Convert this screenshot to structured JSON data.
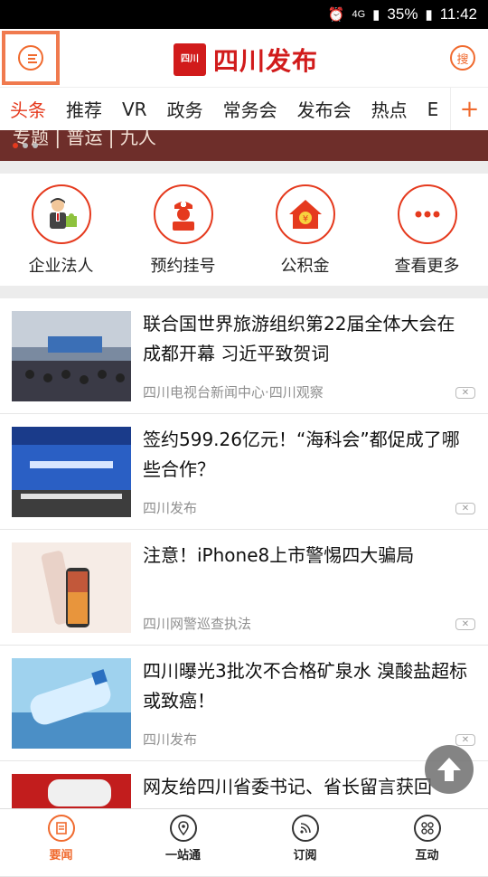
{
  "status_bar": {
    "network": "4G",
    "battery": "35%",
    "time": "11:42"
  },
  "header": {
    "logo_seal": "四川",
    "logo_text": "四川发布",
    "search_label": "搜"
  },
  "tabs": [
    "头条",
    "推荐",
    "VR",
    "政务",
    "常务会",
    "发布会",
    "热点",
    "E"
  ],
  "banner": {
    "text": "专题 | 普运 | 九人"
  },
  "quick_links": [
    {
      "label": "企业法人",
      "icon": "business-person-icon"
    },
    {
      "label": "预约挂号",
      "icon": "nurse-icon"
    },
    {
      "label": "公积金",
      "icon": "house-fund-icon"
    },
    {
      "label": "查看更多",
      "icon": "more-icon"
    }
  ],
  "news": [
    {
      "title": "联合国世界旅游组织第22届全体大会在成都开幕 习近平致贺词",
      "source": "四川电视台新闻中心·四川观察"
    },
    {
      "title": "签约599.26亿元！“海科会”都促成了哪些合作？",
      "source": "四川发布"
    },
    {
      "title": "注意！iPhone8上市警惕四大骗局",
      "source": "四川网警巡查执法"
    },
    {
      "title": "四川曝光3批次不合格矿泉水 溴酸盐超标或致癌！",
      "source": "四川发布"
    },
    {
      "title": "网友给四川省委书记、省长留言获回",
      "source": ""
    }
  ],
  "bottom_nav": [
    {
      "label": "要闻",
      "icon": "news-icon"
    },
    {
      "label": "一站通",
      "icon": "location-icon"
    },
    {
      "label": "订阅",
      "icon": "rss-icon"
    },
    {
      "label": "互动",
      "icon": "grid-icon"
    }
  ],
  "colors": {
    "accent": "#e53a1e",
    "orange": "#f06a2e"
  }
}
